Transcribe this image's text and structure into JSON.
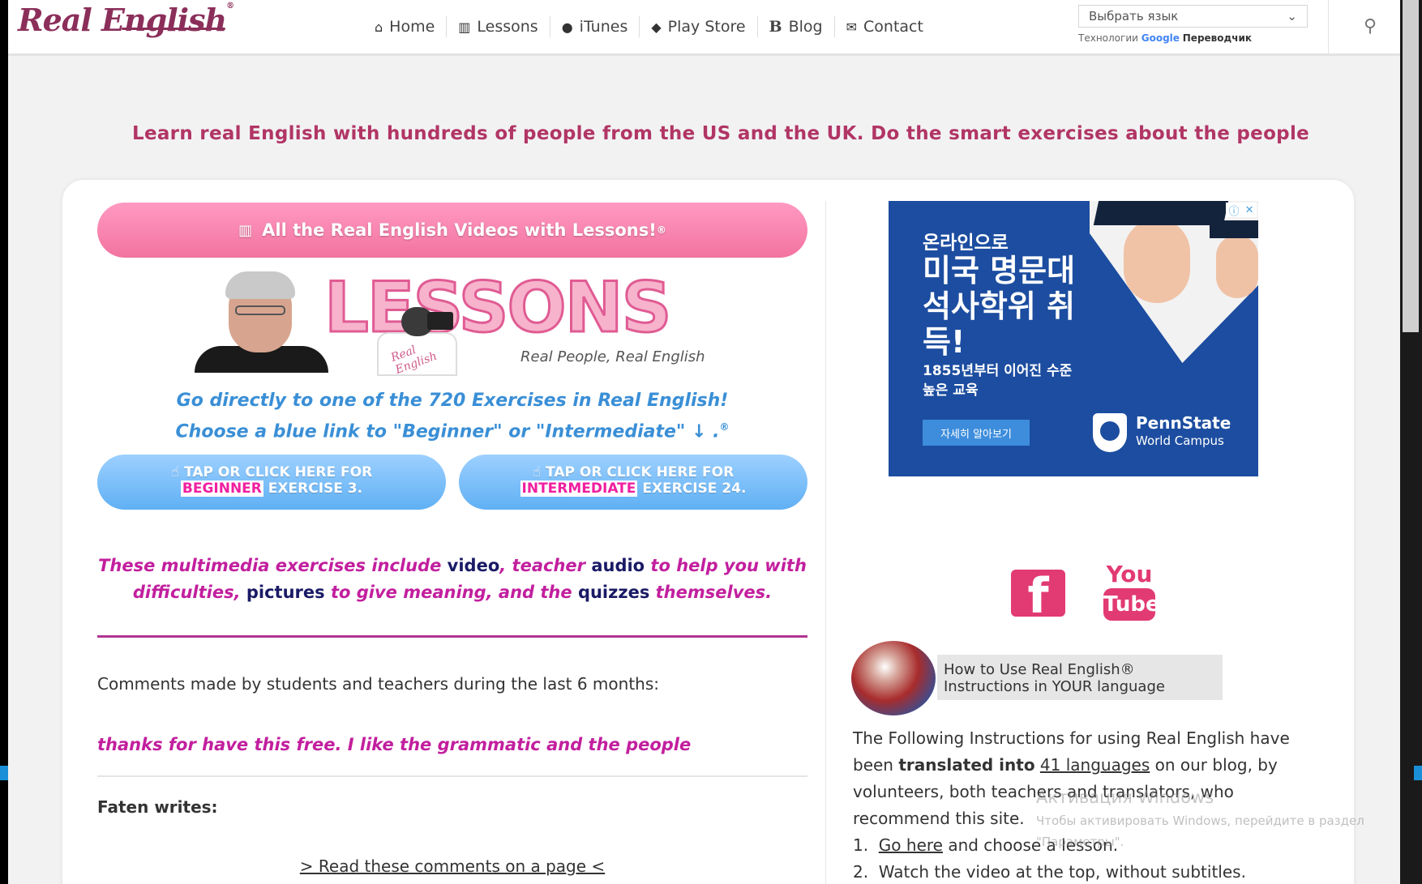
{
  "header": {
    "logo_text": "Real English",
    "logo_mark": "®",
    "nav": [
      {
        "label": "Home",
        "icon": "home-icon"
      },
      {
        "label": "Lessons",
        "icon": "book-icon"
      },
      {
        "label": "iTunes",
        "icon": "apple-icon"
      },
      {
        "label": "Play Store",
        "icon": "android-icon"
      },
      {
        "label": "Blog",
        "icon": "blog-icon"
      },
      {
        "label": "Contact",
        "icon": "mail-icon"
      }
    ],
    "language_select": "Выбрать язык",
    "powered_prefix": "Технологии",
    "powered_brand": "Google",
    "powered_suffix": "Переводчик"
  },
  "tagline": "Learn real English with hundreds of people from the US and the UK. Do the smart exercises about the people",
  "main": {
    "all_videos_button": "All the Real English Videos with Lessons!",
    "all_videos_mark": "®",
    "banner_title": "LESSONS",
    "banner_badge": "Real English",
    "banner_subtitle": "Real People, Real English",
    "direct_line1": "Go directly to one of the 720 Exercises in Real English!",
    "direct_line2": "Choose a blue link to \"Beginner\" or \"Intermediate\" ↓ .",
    "direct_mark": "®",
    "beginner_btn": {
      "line1": "TAP OR CLICK HERE FOR",
      "level": "BEGINNER",
      "rest": " EXERCISE 3."
    },
    "intermediate_btn": {
      "line1": "TAP OR CLICK HERE FOR",
      "level": "INTERMEDIATE",
      "rest": " EXERCISE 24."
    },
    "multimedia": {
      "p1": "These multimedia exercises include ",
      "k1": "video",
      "p2": ", teacher ",
      "k2": "audio",
      "p3": " to help you with difficulties, ",
      "k3": "pictures",
      "p4": " to give meaning, and the ",
      "k4": "quizzes",
      "p5": " themselves."
    },
    "comments_heading": "Comments made by students and teachers during the last 6 months:",
    "comment_quote": "thanks for have this free. I like the grammatic and the people",
    "comment_author": "Faten writes:",
    "read_link": "> Read these comments on a page <"
  },
  "ad": {
    "line1": "온라인으로",
    "line2": "미국 명문대 석사학위 취득!",
    "line3": "1855년부터 이어진 수준 높은 교육",
    "button": "자세히 알아보기",
    "brand": "PennState",
    "brand_sub": "World Campus"
  },
  "social": {
    "facebook": "f",
    "youtube_top": "You",
    "youtube_bottom": "Tube"
  },
  "howto": {
    "line1": "How to Use Real English®",
    "line2": "Instructions in YOUR language"
  },
  "instructions": {
    "t1": "The Following Instructions for using Real English have been ",
    "bold": "translated into",
    "sp": " ",
    "link": "41 languages",
    "t2": " on our blog, by volunteers, both teachers and translators, who recommend this site.",
    "step1_link": "Go here",
    "step1_rest": " and choose a lesson.",
    "step2": "Watch the video at the top, without subtitles."
  },
  "watermark": {
    "title": "Активация Windows",
    "body": "Чтобы активировать Windows, перейдите в раздел \"Параметры\"."
  }
}
